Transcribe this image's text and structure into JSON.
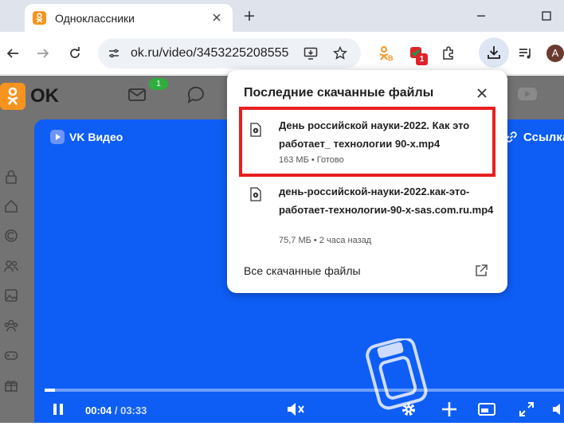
{
  "tab": {
    "title": "Одноклассники",
    "favicon": "odnoklassniki-icon"
  },
  "omnibox": {
    "url": "ok.ru/video/3453225208555"
  },
  "extensions": {
    "badge_count": "1"
  },
  "profile": {
    "initial": "A"
  },
  "site": {
    "logo_text": "OK",
    "messages_count": "1"
  },
  "video": {
    "brand": "VK Видео",
    "share_label": "Ссылка",
    "current_time": "00:04",
    "separator": " / ",
    "total_time": "03:33",
    "progress": 0.02
  },
  "downloads_popup": {
    "title": "Последние скачанные файлы",
    "items": [
      {
        "name": "День российской науки-2022. Как это работает_ технологии 90-х.mp4",
        "meta": "163 МБ • Готово"
      },
      {
        "name": "день-российской-науки-2022.как-это-работает-технологии-90-х-sas.com.ru.mp4",
        "meta": "75,7 МБ • 2 часа назад"
      }
    ],
    "all_downloads_label": "Все скачанные файлы"
  },
  "colors": {
    "accent": "#0e5ef5",
    "ok_orange": "#f7931e",
    "highlight": "#e81f1f"
  }
}
